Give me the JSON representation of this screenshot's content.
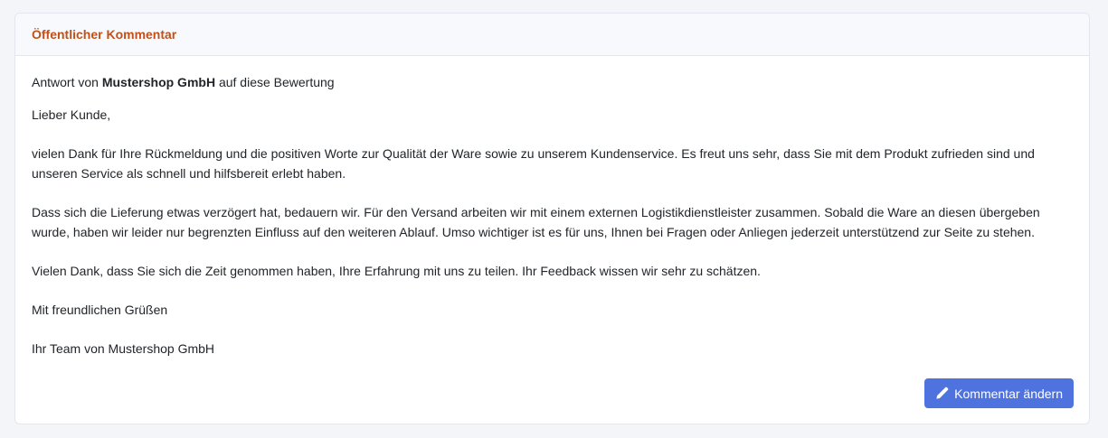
{
  "card": {
    "title": "Öffentlicher Kommentar"
  },
  "reply": {
    "intro_prefix": "Antwort von",
    "shop_name": "Mustershop GmbH",
    "intro_suffix": "auf diese Bewertung",
    "greeting": "Lieber Kunde,",
    "paragraph_1": "vielen Dank für Ihre Rückmeldung und die positiven Worte zur Qualität der Ware sowie zu unserem Kundenservice. Es freut uns sehr, dass Sie mit dem Produkt zufrieden sind und unseren Service als schnell und hilfsbereit erlebt haben.",
    "paragraph_2": "Dass sich die Lieferung etwas verzögert hat, bedauern wir. Für den Versand arbeiten wir mit einem externen Logistikdienstleister zusammen. Sobald die Ware an diesen übergeben wurde, haben wir leider nur begrenzten Einfluss auf den weiteren Ablauf. Umso wichtiger ist es für uns, Ihnen bei Fragen oder Anliegen jederzeit unterstützend zur Seite zu stehen.",
    "paragraph_3": "Vielen Dank, dass Sie sich die Zeit genommen haben, Ihre Erfahrung mit uns zu teilen. Ihr Feedback wissen wir sehr zu schätzen.",
    "closing": "Mit freundlichen Grüßen",
    "signature": "Ihr Team von Mustershop GmbH"
  },
  "actions": {
    "edit_label": "Kommentar ändern",
    "edit_icon": "pencil-icon"
  },
  "colors": {
    "accent": "#4e73df",
    "title": "#c0511a"
  }
}
